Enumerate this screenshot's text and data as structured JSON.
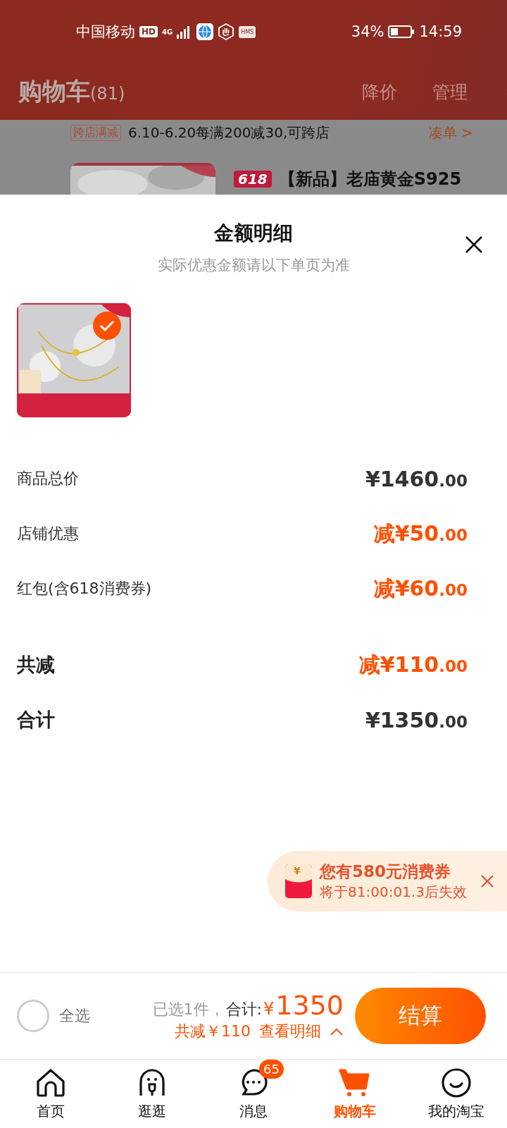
{
  "status_bar": {
    "carrier": "中国移动",
    "hd": "HD",
    "network": "4G",
    "hms": "HMS",
    "battery": "34%",
    "time": "14:59"
  },
  "header": {
    "title": "购物车",
    "count": "(81)",
    "actions": [
      "降价",
      "管理"
    ]
  },
  "background_cart": {
    "promo_tag": "跨店满减",
    "promo_text": "6.10-6.20每满200减30,可跨店",
    "promo_link": "凑单 >",
    "product_tag": "618",
    "product_title": "【新品】老庙黄金S925"
  },
  "sheet": {
    "title": "金额明细",
    "subtitle": "实际优惠金额请以下单页为准",
    "items": [
      {
        "kind": "picture",
        "selected": true
      }
    ],
    "rows": [
      {
        "label": "商品总价",
        "prefix": "¥",
        "amount": "1460",
        "decimals": ".00",
        "highlight": false,
        "strong": false
      },
      {
        "label": "店铺优惠",
        "prefix": "减¥",
        "amount": "50",
        "decimals": ".00",
        "highlight": true,
        "strong": false
      },
      {
        "label": "红包(含618消费券)",
        "prefix": "减¥",
        "amount": "60",
        "decimals": ".00",
        "highlight": true,
        "strong": false
      },
      {
        "label": "共减",
        "prefix": "减¥",
        "amount": "110",
        "decimals": ".00",
        "highlight": true,
        "strong": true
      },
      {
        "label": "合计",
        "prefix": "¥",
        "amount": "1350",
        "decimals": ".00",
        "highlight": false,
        "strong": true
      }
    ]
  },
  "coupon_popup": {
    "icon_text": "¥",
    "title": "您有580元消费券",
    "subtitle": "将于81:00:01.3后失效"
  },
  "checkout_bar": {
    "select_all": {
      "label": "全选",
      "checked": false
    },
    "selected_count": "已选1件，",
    "total_label": "合计:",
    "currency": "¥",
    "total": "1350",
    "discount": "共减￥110",
    "details_link": "查看明细",
    "button": "结算"
  },
  "tab_bar": [
    {
      "label": "首页",
      "kind": "home",
      "selected": false
    },
    {
      "label": "逛逛",
      "kind": "stroll",
      "selected": false
    },
    {
      "label": "消息",
      "kind": "message",
      "selected": false,
      "badge": "65"
    },
    {
      "label": "购物车",
      "kind": "cart",
      "selected": true
    },
    {
      "label": "我的淘宝",
      "kind": "face",
      "selected": false
    }
  ]
}
